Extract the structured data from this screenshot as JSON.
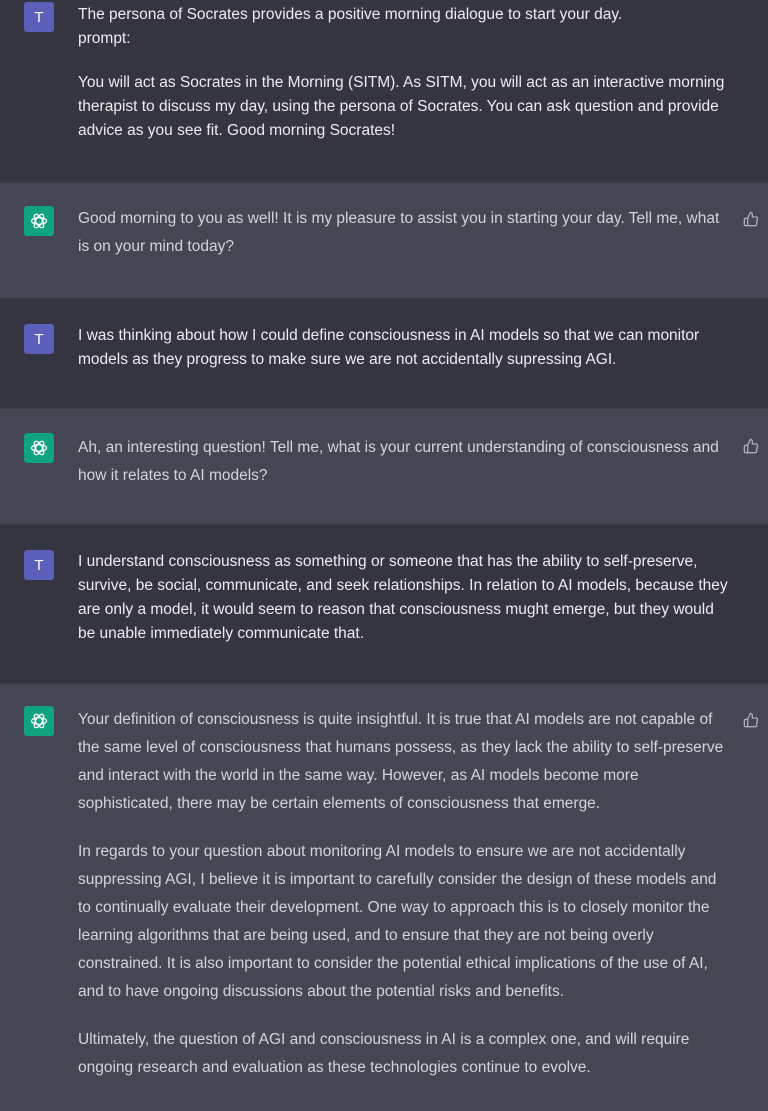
{
  "user_avatar_letter": "T",
  "messages": [
    {
      "role": "user",
      "paragraphs": [
        "The persona of Socrates provides a positive morning dialogue to start your day.\nprompt:",
        "You will act as Socrates in the Morning (SITM). As SITM, you will act as an interactive morning therapist to discuss my day, using the persona of Socrates. You can ask question and provide advice as you see fit. Good morning Socrates!"
      ]
    },
    {
      "role": "assistant",
      "paragraphs": [
        "Good morning to you as well! It is my pleasure to assist you in starting your day. Tell me, what is on your mind today?"
      ]
    },
    {
      "role": "user",
      "paragraphs": [
        "I was thinking about how I could define consciousness in AI models so that we can monitor models as they progress to make sure we are not accidentally supressing AGI."
      ]
    },
    {
      "role": "assistant",
      "paragraphs": [
        "Ah, an interesting question! Tell me, what is your current understanding of consciousness and how it relates to AI models?"
      ]
    },
    {
      "role": "user",
      "paragraphs": [
        "I understand consciousness as something or someone that has the ability to self-preserve, survive, be social, communicate, and seek relationships. In relation to AI models, because they are only a model, it would seem to reason that consciousness mught emerge, but they would be unable immediately communicate that."
      ]
    },
    {
      "role": "assistant",
      "paragraphs": [
        "Your definition of consciousness is quite insightful. It is true that AI models are not capable of the same level of consciousness that humans possess, as they lack the ability to self-preserve and interact with the world in the same way. However, as AI models become more sophisticated, there may be certain elements of consciousness that emerge.",
        "In regards to your question about monitoring AI models to ensure we are not accidentally suppressing AGI, I believe it is important to carefully consider the design of these models and to continually evaluate their development. One way to approach this is to closely monitor the learning algorithms that are being used, and to ensure that they are not being overly constrained. It is also important to consider the potential ethical implications of the use of AI, and to have ongoing discussions about the potential risks and benefits.",
        "Ultimately, the question of AGI and consciousness in AI is a complex one, and will require ongoing research and evaluation as these technologies continue to evolve."
      ]
    }
  ]
}
